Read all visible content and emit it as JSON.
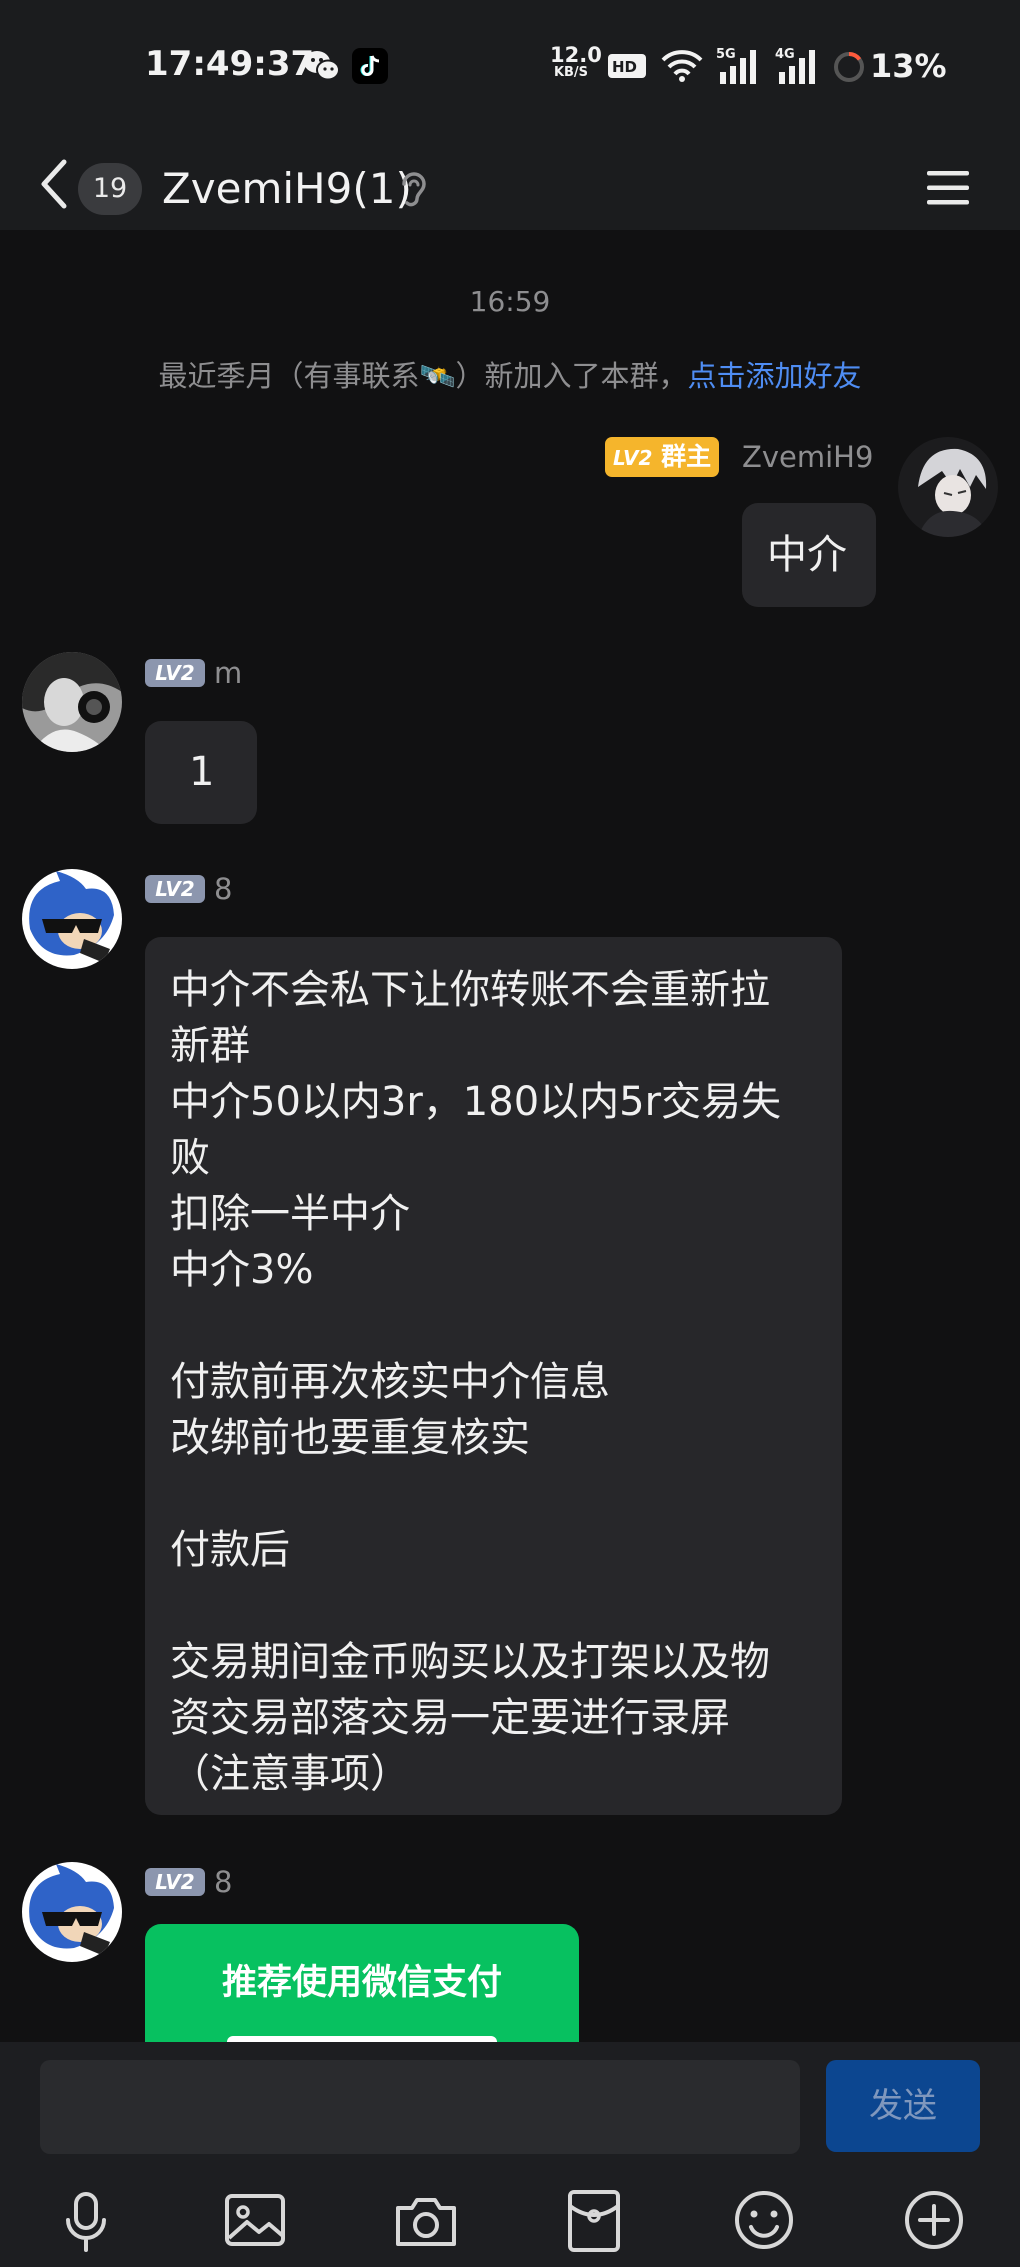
{
  "status_bar": {
    "time": "17:49:37",
    "net_speed_value": "12.0",
    "net_speed_unit": "KB/S",
    "battery": "13%",
    "icons": [
      "wechat-icon",
      "tiktok-icon",
      "hd-icon",
      "wifi-icon",
      "signal-5g-icon",
      "signal-4g-icon",
      "battery-icon"
    ]
  },
  "header": {
    "unread_count": "19",
    "title": "ZvemiH9(1)",
    "icons": [
      "back-icon",
      "ear-icon",
      "menu-icon"
    ]
  },
  "feed": {
    "timestamp": "16:59",
    "system_notice": {
      "text": "最近季月（有事联系🛰️）新加入了本群，",
      "link": "点击添加好友"
    },
    "messages": [
      {
        "sender": "ZvemiH9",
        "level": "LV2",
        "role": "群主",
        "text": "中介"
      },
      {
        "sender": "m",
        "level": "LV2",
        "text": "1"
      },
      {
        "sender": "8",
        "level": "LV2",
        "text": "中介不会私下让你转账不会重新拉\n新群\n中介50以内3r，180以内5r交易失\n败\n扣除一半中介\n中介3%\n\n付款前再次核实中介信息\n改绑前也要重复核实\n\n付款后\n\n交易期间金币购买以及打架以及物\n资交易部落交易一定要进行录屏\n（注意事项）"
      },
      {
        "sender": "8",
        "level": "LV2",
        "card_title": "推荐使用微信支付"
      }
    ]
  },
  "input_bar": {
    "send_label": "发送",
    "input_value": "",
    "tools": [
      "microphone-icon",
      "image-icon",
      "camera-icon",
      "red-packet-icon",
      "emoji-icon",
      "plus-icon"
    ]
  },
  "colors": {
    "background": "#111112",
    "bar": "#1b1c1e",
    "bubble": "#27272a",
    "link": "#4f8df3",
    "owner_badge": "#f5b52c",
    "level_badge": "#8c96ae",
    "wechat_green": "#07c160",
    "send_button": "#0c4690"
  }
}
